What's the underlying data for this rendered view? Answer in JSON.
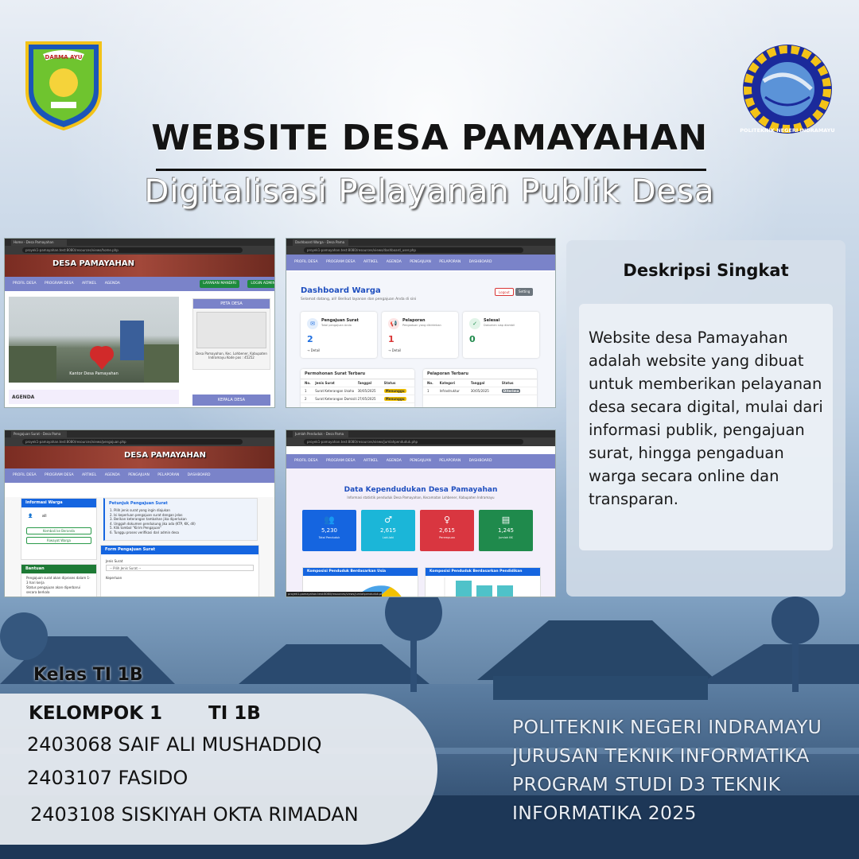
{
  "header": {
    "title": "WEBSITE DESA PAMAYAHAN",
    "subtitle": "Digitalisasi Pelayanan Publik Desa",
    "left_logo_text": "DARMA AYU",
    "right_logo_text": "POLITEKNIK NEGERI INDRAMAYU"
  },
  "shot1": {
    "tab": "Home - Desa Pamayahan",
    "url": "proyek1-pamayahan.test:8080/resources/views/home.php",
    "site_name": "DESA PAMAYAHAN",
    "nav": [
      "PROFIL DESA",
      "PROGRAM DESA",
      "ARTIKEL",
      "AGENDA"
    ],
    "btn_layanan": "LAYANAN MANDIRI",
    "btn_login": "LOGIN ADMIN",
    "hero_caption": "Kantor Desa Pamayahan",
    "map_title": "PETA DESA",
    "map_address": "Desa Pamayahan, Kec. Lohbener, Kabupaten Indramayu Kode pos : 45252",
    "agenda": "AGENDA",
    "kepala": "KEPALA DESA"
  },
  "shot2": {
    "tab": "Dashboard Warga - Desa Pama",
    "url": "proyek1-pamayahan.test:8080/resources/views/dashboard_user.php",
    "nav": [
      "PROFIL DESA",
      "PROGRAM DESA",
      "ARTIKEL",
      "AGENDA",
      "PENGAJUAN",
      "PELAPORAN",
      "DASHBOARD"
    ],
    "title": "Dashboard Warga",
    "subtitle": "Selamat datang, ali! Berikut layanan dan pengajuan Anda di sini",
    "btn_logout": "Logout",
    "btn_setting": "Setting",
    "cards": [
      {
        "title": "Pengajuan Surat",
        "desc": "Total pengajuan Anda",
        "value": "2",
        "link": "→ Detail",
        "color": "#1f6fe0",
        "bg": "#e3eefc",
        "icon": "✉"
      },
      {
        "title": "Pelaporan",
        "desc": "Pengaduan yang dikirimkan",
        "value": "1",
        "link": "→ Detail",
        "color": "#d93636",
        "bg": "#fde5e5",
        "icon": "📢"
      },
      {
        "title": "Selesai",
        "desc": "Dokumen siap diambil",
        "value": "0",
        "link": "",
        "color": "#1f8a4c",
        "bg": "#e1f4e8",
        "icon": "✓"
      }
    ],
    "table_surat": {
      "title": "Permohonan Surat Terbaru",
      "headers": [
        "No.",
        "Jenis Surat",
        "Tanggal",
        "Status"
      ],
      "rows": [
        [
          "1",
          "Surat Keterangan Usaha",
          "30/05/2025",
          "Menunggu"
        ],
        [
          "2",
          "Surat Keterangan Domisili",
          "27/05/2025",
          "Menunggu"
        ]
      ]
    },
    "table_lapor": {
      "title": "Pelaporan Terbaru",
      "headers": [
        "No.",
        "Kategori",
        "Tanggal",
        "Status"
      ],
      "rows": [
        [
          "1",
          "Infrastruktur",
          "30/05/2025",
          "Diterima"
        ]
      ]
    }
  },
  "shot3": {
    "tab": "Pengajuan Surat - Desa Pama",
    "url": "proyek1-pamayahan.test:8080/resources/views/pengajuan.php",
    "site_name": "DESA PAMAYAHAN",
    "nav": [
      "PROFIL DESA",
      "PROGRAM DESA",
      "ARTIKEL",
      "AGENDA",
      "PENGAJUAN",
      "PELAPORAN",
      "DASHBOARD"
    ],
    "info_title": "Informasi Warga",
    "user": "ali",
    "btn_kembali": "Kembali ke Beranda",
    "btn_riwayat": "Riwayat Warga",
    "bantuan_title": "Bantuan",
    "bantuan_items": [
      "Pengajuan surat akan diproses dalam 1-3 hari kerja",
      "Status pengajuan akan diperbarui secara berkala"
    ],
    "petunjuk_title": "Petunjuk Pengajuan Surat",
    "petunjuk_items": [
      "1. Pilih jenis surat yang ingin diajukan",
      "2. Isi keperluan pengajuan surat dengan jelas",
      "3. Berikan keterangan tambahan jika diperlukan",
      "4. Unggah dokumen pendukung jika ada (KTP, KK, dll)",
      "5. Klik tombol \"Kirim Pengajuan\"",
      "6. Tunggu proses verifikasi dari admin desa"
    ],
    "form_title": "Form Pengajuan Surat",
    "field_jenis": "Jenis Surat",
    "field_jenis_ph": "-- Pilih Jenis Surat --",
    "field_keperluan": "Keperluan"
  },
  "shot4": {
    "tab": "Jumlah Penduduk - Desa Pama",
    "url": "proyek1-pamayahan.test:8080/resources/views/jumlahpenduduk.php",
    "nav": [
      "PROFIL DESA",
      "PROGRAM DESA",
      "ARTIKEL",
      "AGENDA",
      "PENGAJUAN",
      "PELAPORAN",
      "DASHBOARD"
    ],
    "title": "Data Kependudukan Desa Pamayahan",
    "subtitle": "Informasi statistik penduduk Desa Pamayahan, Kecamatan Lohbener, Kabupaten Indramayu",
    "stats": [
      {
        "icon": "👥",
        "value": "5,230",
        "label": "Total Penduduk",
        "color": "#1565e0"
      },
      {
        "icon": "♂",
        "value": "2,615",
        "label": "Laki-laki",
        "color": "#1bb6d8"
      },
      {
        "icon": "♀",
        "value": "2,615",
        "label": "Perempuan",
        "color": "#d93640"
      },
      {
        "icon": "▤",
        "value": "1,245",
        "label": "Jumlah KK",
        "color": "#1f8a4c"
      }
    ],
    "chart_usia": "Komposisi Penduduk Berdasarkan Usia",
    "chart_pendidikan": "Komposisi Penduduk Berdasarkan Pendidikan",
    "status_url": "proyek1-pamayahan.test:8080/resources/views/jumlahpenduduk.php"
  },
  "description": {
    "title": "Deskripsi Singkat",
    "body": "Website desa Pamayahan adalah website yang dibuat untuk memberikan pelayanan desa secara digital, mulai dari informasi publik, pengajuan surat, hingga pengaduan warga secara online dan transparan."
  },
  "team": {
    "kelas": "Kelas TI 1B",
    "kelompok": "KELOMPOK 1",
    "kelompok_ti": "TI 1B",
    "members": [
      "2403068 SAIF ALI MUSHADDIQ",
      "2403107 FASIDO",
      "2403108 SISKIYAH OKTA RIMADAN"
    ]
  },
  "institution": {
    "lines": [
      "POLITEKNIK NEGERI INDRAMAYU",
      "JURUSAN TEKNIK INFORMATIKA",
      "PROGRAM STUDI D3 TEKNIK",
      "INFORMATIKA 2025"
    ]
  }
}
